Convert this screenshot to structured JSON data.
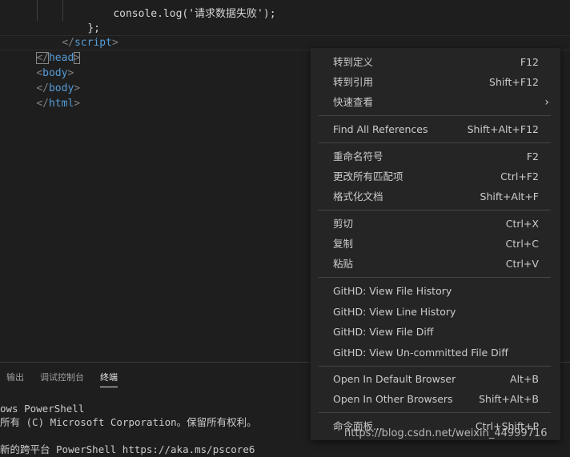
{
  "editor": {
    "lines": {
      "l0_code": "console.log('请求数据失败');",
      "l1_code": "};",
      "l2_open": "</",
      "l2_tag": "script",
      "l2_close": ">",
      "l3_open": "</",
      "l3_tag": "head",
      "l3_close": ">",
      "l4_open": "<",
      "l4_tag": "body",
      "l4_close": ">",
      "l5_open": "</",
      "l5_tag": "body",
      "l5_close": ">",
      "l6_open": "</",
      "l6_tag": "html",
      "l6_close": ">"
    }
  },
  "panel": {
    "tabs": {
      "output": "输出",
      "debug_console": "调试控制台",
      "terminal": "终端"
    },
    "terminal_lines": {
      "t0": "ows PowerShell",
      "t1": "所有 (C) Microsoft Corporation。保留所有权利。",
      "t2": "新的跨平台 PowerShell https://aka.ms/pscore6"
    }
  },
  "context_menu": {
    "items": [
      {
        "label": "转到定义",
        "shortcut": "F12"
      },
      {
        "label": "转到引用",
        "shortcut": "Shift+F12"
      },
      {
        "label": "快速查看",
        "shortcut": ""
      },
      {
        "label": "Find All References",
        "shortcut": "Shift+Alt+F12"
      },
      {
        "label": "重命名符号",
        "shortcut": "F2"
      },
      {
        "label": "更改所有匹配项",
        "shortcut": "Ctrl+F2"
      },
      {
        "label": "格式化文档",
        "shortcut": "Shift+Alt+F"
      },
      {
        "label": "剪切",
        "shortcut": "Ctrl+X"
      },
      {
        "label": "复制",
        "shortcut": "Ctrl+C"
      },
      {
        "label": "粘贴",
        "shortcut": "Ctrl+V"
      },
      {
        "label": "GitHD: View File History",
        "shortcut": ""
      },
      {
        "label": "GitHD: View Line History",
        "shortcut": ""
      },
      {
        "label": "GitHD: View File Diff",
        "shortcut": ""
      },
      {
        "label": "GitHD: View Un-committed File Diff",
        "shortcut": ""
      },
      {
        "label": "Open In Default Browser",
        "shortcut": "Alt+B"
      },
      {
        "label": "Open In Other Browsers",
        "shortcut": "Shift+Alt+B"
      },
      {
        "label": "命令面板...",
        "shortcut": "Ctrl+Shift+P"
      }
    ],
    "submenu_arrow_icon": "chevron-right-icon"
  },
  "watermark": "https://blog.csdn.net/weixin_44999716",
  "colors": {
    "editor_bg": "#1e1e1e",
    "menu_bg": "#252526",
    "tag": "#569cd6",
    "string": "#ce9178"
  }
}
